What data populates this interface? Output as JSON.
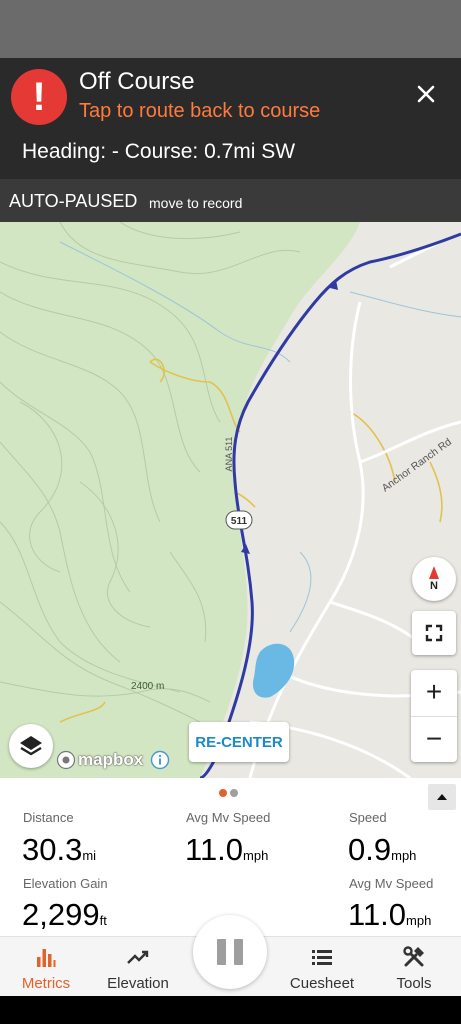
{
  "alert": {
    "title": "Off Course",
    "subtitle": "Tap to route back to course",
    "heading_line": "Heading: - Course: 0.7mi SW",
    "icon": "exclamation-icon",
    "close_icon": "close-icon"
  },
  "status": {
    "title": "AUTO-PAUSED",
    "subtitle": "move to record"
  },
  "map": {
    "road_labels": [
      "Anchor Ranch Rd",
      "2400 m",
      "ANA 511"
    ],
    "route_shield": "511",
    "compass_label": "N",
    "recenter_label": "RE-CENTER",
    "attribution": "mapbox",
    "zoom_in": "+",
    "zoom_out": "−",
    "colors": {
      "route": "#2f3ba3",
      "terrain": "#d3e6c3",
      "road": "#ffffff",
      "water": "#69b9e4",
      "minor_road": "#e2c250"
    }
  },
  "metrics": {
    "distance": {
      "label": "Distance",
      "value": "30.3",
      "unit": "mi"
    },
    "avg_mv_speed": {
      "label": "Avg Mv Speed",
      "value": "11.0",
      "unit": "mph"
    },
    "speed": {
      "label": "Speed",
      "value": "0.9",
      "unit": "mph"
    },
    "elevation_gain": {
      "label": "Elevation Gain",
      "value": "2,299",
      "unit": "ft"
    },
    "avg_mv_speed_2": {
      "label": "Avg Mv Speed",
      "value": "11.0",
      "unit": "mph"
    }
  },
  "nav": {
    "items": [
      {
        "label": "Metrics",
        "icon": "bar-chart-icon",
        "active": true
      },
      {
        "label": "Elevation",
        "icon": "trend-line-icon",
        "active": false
      },
      {
        "label": "Cuesheet",
        "icon": "list-icon",
        "active": false
      },
      {
        "label": "Tools",
        "icon": "tools-icon",
        "active": false
      }
    ],
    "accent": "#e2622c"
  }
}
